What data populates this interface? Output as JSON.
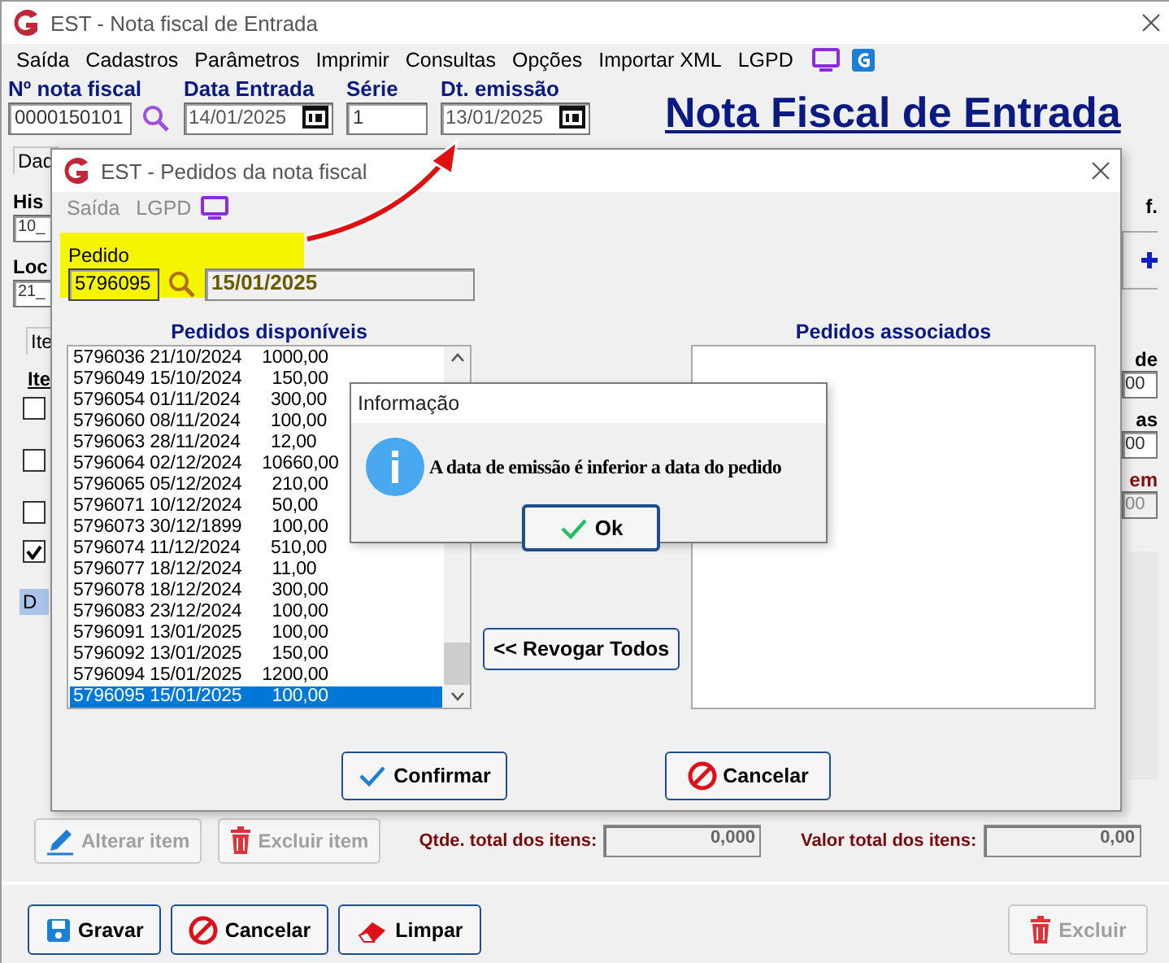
{
  "window": {
    "title": "EST - Nota fiscal de Entrada"
  },
  "menu": [
    "Saída",
    "Cadastros",
    "Parâmetros",
    "Imprimir",
    "Consultas",
    "Opções",
    "Importar XML",
    "LGPD"
  ],
  "header": {
    "fields": [
      {
        "label": "Nº nota fiscal",
        "value": "0000150101",
        "kind": "search"
      },
      {
        "label": "Data Entrada",
        "value": "14/01/2025",
        "kind": "date"
      },
      {
        "label": "Série",
        "value": "1",
        "kind": "plain"
      },
      {
        "label": "Dt. emissão",
        "value": "13/01/2025",
        "kind": "date"
      }
    ],
    "heading": "Nota Fiscal de Entrada"
  },
  "background_form": {
    "tab_1": "Dad",
    "label_1": "His",
    "field_1": "10_",
    "label_2": "Loc",
    "field_2": "21_",
    "tab_2": "Ite",
    "label_3": "Ite",
    "checkboxes": [
      {
        "checked": false
      },
      {
        "checked": false
      },
      {
        "checked": false
      },
      {
        "checked": true
      }
    ],
    "list_cell": "D",
    "right_label_1": "f.",
    "right_label_2": "de",
    "right_field_1": "00",
    "right_label_3": "as",
    "right_field_2": "00",
    "right_label_4": "em",
    "right_field_3": "00"
  },
  "item_actions": [
    {
      "label": "Alterar item",
      "disabled": true
    },
    {
      "label": "Excluir item",
      "disabled": true
    }
  ],
  "totals": [
    {
      "label": "Qtde. total dos itens:",
      "value": "0,000"
    },
    {
      "label": "Valor total dos itens:",
      "value": "0,00"
    }
  ],
  "footer_buttons": [
    {
      "label": "Gravar",
      "disabled": false
    },
    {
      "label": "Cancelar",
      "disabled": false
    },
    {
      "label": "Limpar",
      "disabled": false
    },
    {
      "label": "Excluir",
      "disabled": true
    }
  ],
  "orders_dialog": {
    "title": "EST - Pedidos da nota fiscal",
    "menu": [
      "Saída",
      "LGPD"
    ],
    "pedido": {
      "label": "Pedido",
      "value": "5796095",
      "date": "15/01/2025"
    },
    "available_title": "Pedidos disponíveis",
    "associated_title": "Pedidos associados",
    "available": [
      {
        "text": "5796036 21/10/2024    1000,00",
        "selected": false
      },
      {
        "text": "5796049 15/10/2024      150,00",
        "selected": false
      },
      {
        "text": "5796054 01/11/2024      300,00",
        "selected": false
      },
      {
        "text": "5796060 08/11/2024      100,00",
        "selected": false
      },
      {
        "text": "5796063 28/11/2024      12,00",
        "selected": false
      },
      {
        "text": "5796064 02/12/2024    10660,00",
        "selected": false
      },
      {
        "text": "5796065 05/12/2024      210,00",
        "selected": false
      },
      {
        "text": "5796071 10/12/2024      50,00",
        "selected": false
      },
      {
        "text": "5796073 30/12/1899      100,00",
        "selected": false
      },
      {
        "text": "5796074 11/12/2024      510,00",
        "selected": false
      },
      {
        "text": "5796077 18/12/2024      11,00",
        "selected": false
      },
      {
        "text": "5796078 18/12/2024      300,00",
        "selected": false
      },
      {
        "text": "5796083 23/12/2024      100,00",
        "selected": false
      },
      {
        "text": "5796091 13/01/2025      100,00",
        "selected": false
      },
      {
        "text": "5796092 13/01/2025      150,00",
        "selected": false
      },
      {
        "text": "5796094 15/01/2025    1200,00",
        "selected": false
      },
      {
        "text": "5796095 15/01/2025      100,00",
        "selected": true
      }
    ],
    "revoke_button": "<< Revogar Todos",
    "buttons": [
      {
        "label": "Confirmar"
      },
      {
        "label": "Cancelar"
      }
    ]
  },
  "message_box": {
    "title": "Informação",
    "message": "A data de emissão é inferior a data do pedido",
    "button": "Ok"
  }
}
